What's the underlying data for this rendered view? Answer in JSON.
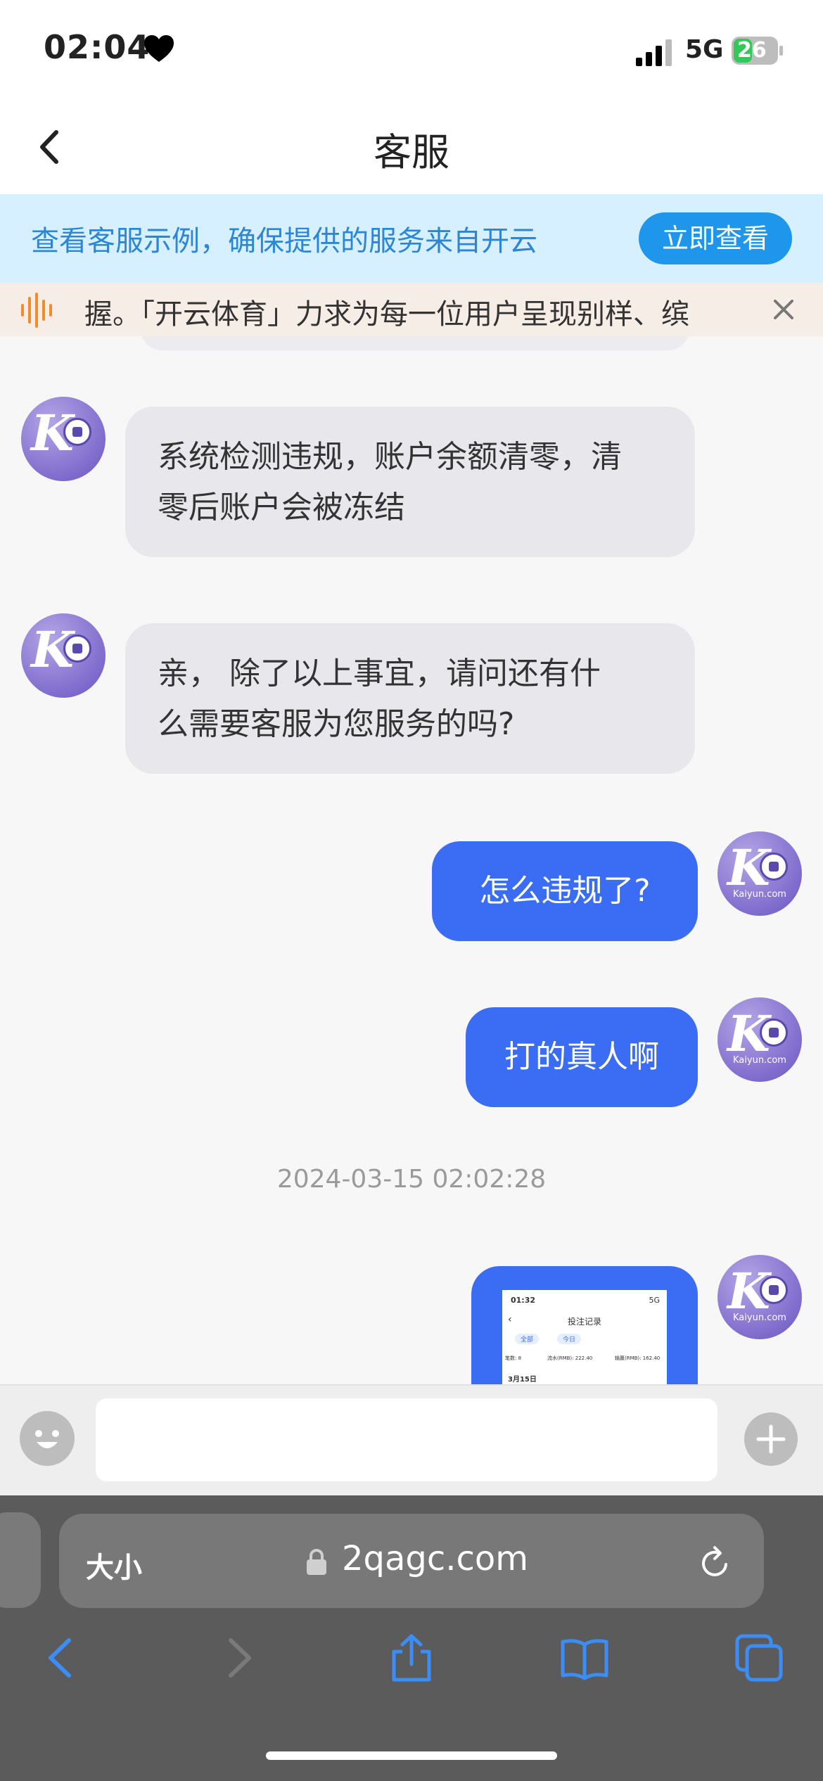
{
  "status_bar": {
    "time": "02:04",
    "network": "5G",
    "battery": "26"
  },
  "header": {
    "title": "客服"
  },
  "notice": {
    "text": "查看客服示例，确保提供的服务来自开云",
    "button_label": "立即查看"
  },
  "marquee": {
    "text": "握。「开云体育」力求为每一位用户呈现别样、缤"
  },
  "avatar": {
    "brand": "Kaiyun.com"
  },
  "messages": {
    "in_1_line1": "系统检测违规，账户余额清零，清",
    "in_1_line2": "零后账户会被冻结",
    "in_2_line1": "亲， 除了以上事宜，请问还有什",
    "in_2_line2": "么需要客服为您服务的吗?",
    "out_1": "怎么违规了?",
    "out_2": "打的真人啊",
    "timestamp": "2024-03-15 02:02:28"
  },
  "screenshot_thumb": {
    "time": "01:32",
    "network": "5G",
    "title": "投注记录",
    "filter_1": "全部",
    "filter_2": "今日",
    "stat_1": "笔数: 8",
    "stat_2": "流水(RMB): 222.40",
    "stat_3": "输赢(RMB): 162.40",
    "date": "3月15日"
  },
  "browser": {
    "aa_label": "大小",
    "url": "2qagc.com"
  },
  "colors": {
    "accent_blue": "#3a6cf4",
    "banner_bg": "#d6f0ff",
    "banner_text": "#2c86d6",
    "button_blue": "#1e96ec",
    "browser_bg": "#5b5b5b"
  }
}
